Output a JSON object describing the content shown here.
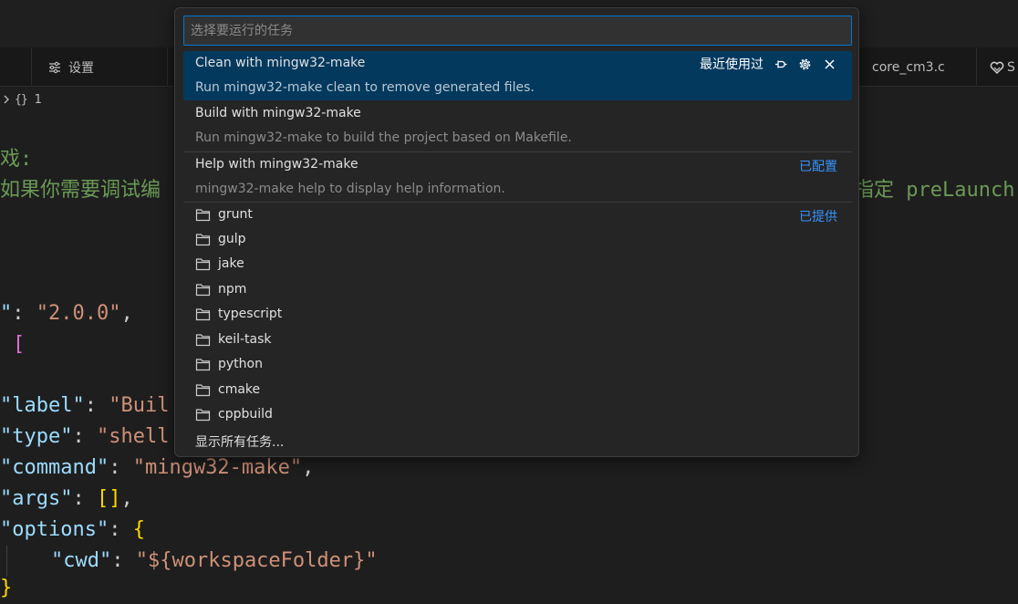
{
  "tabs": {
    "settings": "设置",
    "core_file": "core_cm3.c",
    "partial": "S"
  },
  "breadcrumb": {
    "braces": "{}",
    "count": "1"
  },
  "code": {
    "comment1": "戏:",
    "comment2_left": "如果你需要调试编",
    "comment2_right_a": "指定 ",
    "comment2_right_b": "preLaunch",
    "version_key": "\"",
    "version_sep": ": ",
    "version_val": "\"2.0.0\"",
    "version_comma": ",",
    "tasks_bracket": "[",
    "label_key": "\"label\"",
    "label_val": "\"Buil",
    "type_key": "\"type\"",
    "type_val": "\"shell",
    "command_key": "\"command\"",
    "command_val": "\"mingw32-make\"",
    "args_key": "\"args\"",
    "args_val": "[]",
    "options_key": "\"options\"",
    "options_brace": "{",
    "cwd_key": "\"cwd\"",
    "cwd_val": "\"${workspaceFolder}\"",
    "closing": "}"
  },
  "quick_pick": {
    "placeholder": "选择要运行的任务",
    "recent_label": "最近使用过",
    "items": [
      {
        "label": "Clean with mingw32-make",
        "desc": "Run mingw32-make clean to remove generated files."
      },
      {
        "label": "Build with mingw32-make",
        "desc": "Run mingw32-make to build the project based on Makefile."
      },
      {
        "label": "Help with mingw32-make",
        "desc": "mingw32-make help to display help information.",
        "badge": "已配置"
      }
    ],
    "provided_badge": "已提供",
    "folders": [
      "grunt",
      "gulp",
      "jake",
      "npm",
      "typescript",
      "keil-task",
      "python",
      "cmake",
      "cppbuild"
    ],
    "show_all": "显示所有任务..."
  },
  "colors": {
    "accent": "#0078d4",
    "selection": "#04395e",
    "badge": "#3794ff"
  }
}
